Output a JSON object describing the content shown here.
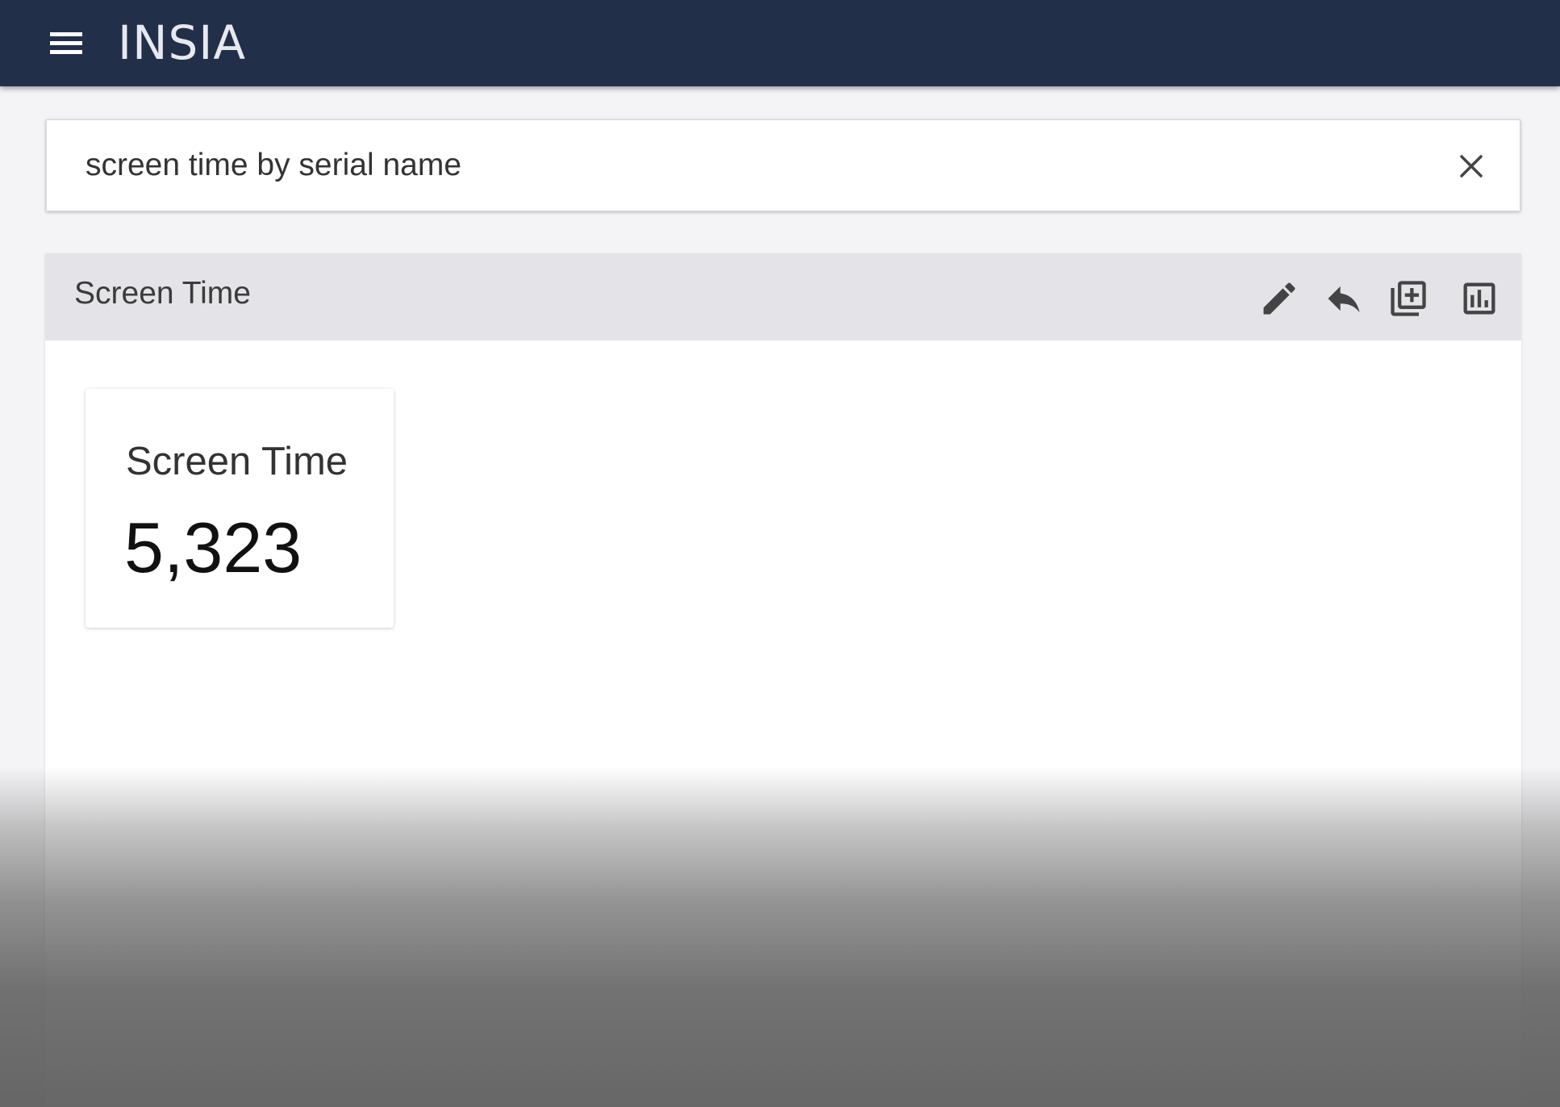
{
  "app": {
    "logo": "INSIA"
  },
  "search": {
    "query": "screen time by serial name"
  },
  "result": {
    "title": "Screen Time",
    "toolbar": [
      "edit-icon",
      "undo-icon",
      "add-to-dashboard-icon",
      "chart-icon"
    ],
    "kpi": {
      "label": "Screen Time",
      "value": "5,323"
    }
  },
  "colors": {
    "topbar": "#222f48",
    "panel_header": "#e4e4e8",
    "background": "#f4f4f6"
  }
}
